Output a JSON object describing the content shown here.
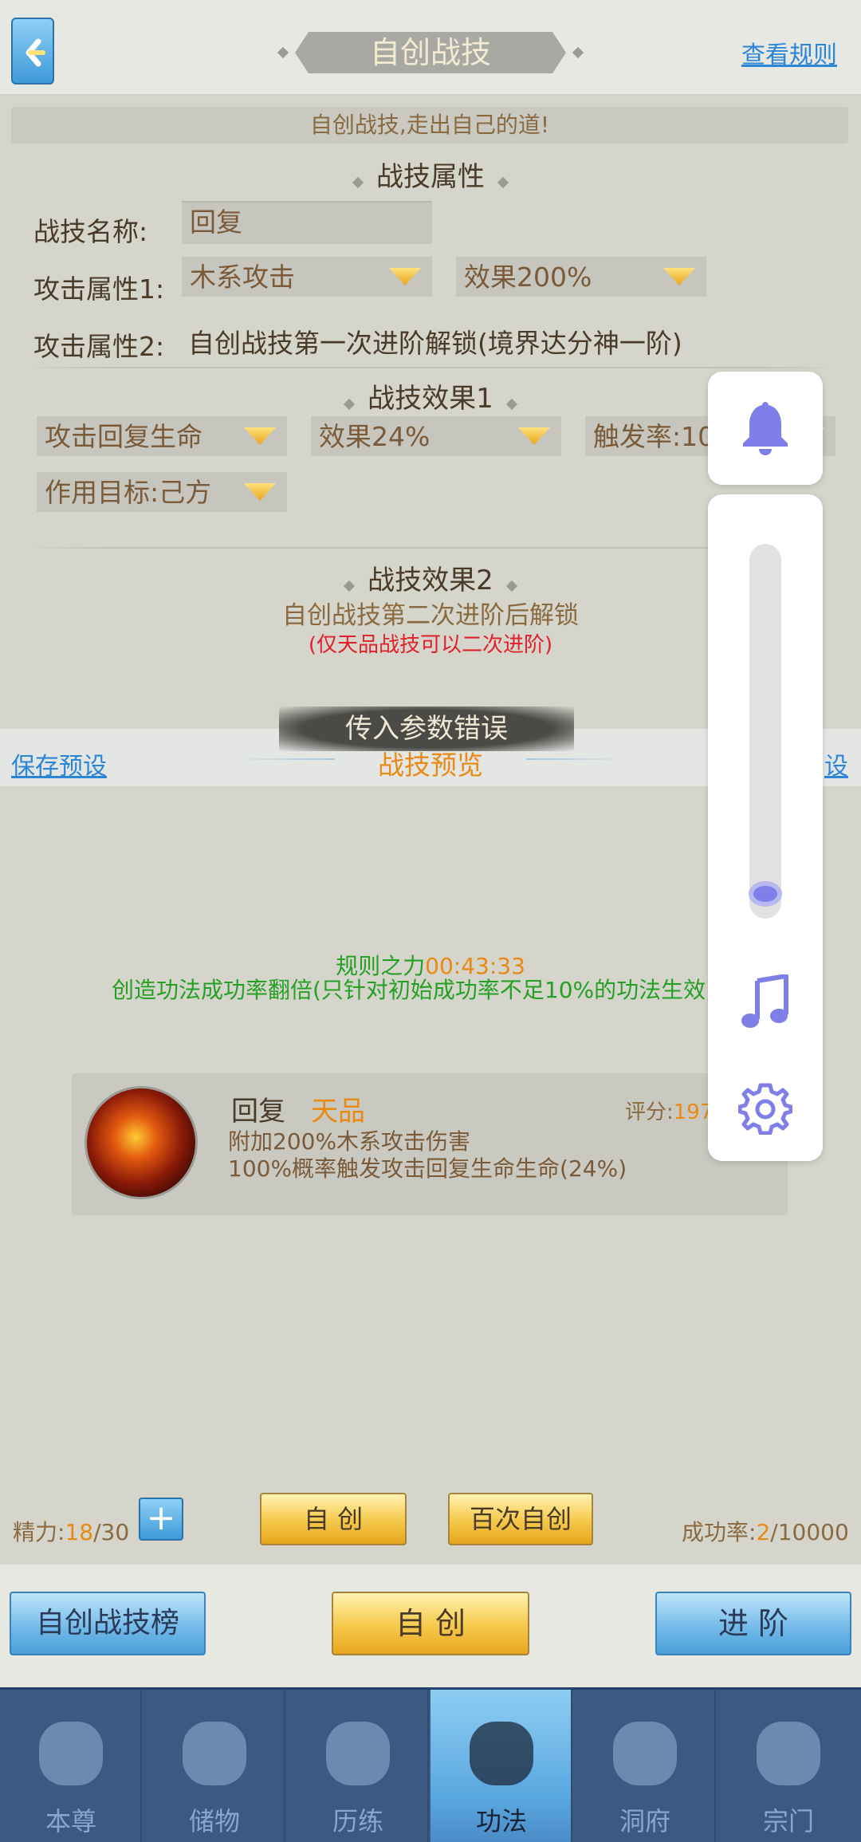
{
  "header": {
    "title": "自创战技",
    "rules_link": "查看规则"
  },
  "slogan": "自创战技,走出自己的道!",
  "attributes": {
    "section_title": "战技属性",
    "name_label": "战技名称:",
    "name_value": "回复",
    "attack1_label": "攻击属性1:",
    "attack1_type": "木系攻击",
    "attack1_effect": "效果200%",
    "attack2_label": "攻击属性2:",
    "attack2_value": "自创战技第一次进阶解锁(境界达分神一阶)"
  },
  "effect1": {
    "section_title": "战技效果1",
    "type": "攻击回复生命",
    "effect": "效果24%",
    "trigger_rate": "触发率:10",
    "target": "作用目标:己方"
  },
  "effect2": {
    "section_title": "战技效果2",
    "locked_text": "自创战技第二次进阶后解锁",
    "note": "(仅天品战技可以二次进阶)"
  },
  "toast": "传入参数错误",
  "preview": {
    "save_preset": "保存预设",
    "title": "战技预览",
    "load_preset": "设"
  },
  "rule_power": {
    "label": "规则之力",
    "timer": "00:43:33",
    "description": "创造功法成功率翻倍(只针对初始成功率不足10%的功法生效)"
  },
  "skill": {
    "name": "回复",
    "grade": "天品",
    "score_label": "评分:",
    "score_value": "197",
    "desc1": "附加200%木系攻击伤害",
    "desc2": "100%概率触发攻击回复生命生命(24%)"
  },
  "energy": {
    "label": "精力:",
    "current": "18",
    "max": "/30"
  },
  "create_buttons": {
    "create": "自 创",
    "hundred": "百次自创"
  },
  "success_rate": {
    "label": "成功率:",
    "current": "2",
    "max": "/10000"
  },
  "actions": {
    "ranking": "自创战技榜",
    "create": "自 创",
    "advance": "进 阶"
  },
  "nav": [
    {
      "label": "本尊",
      "icon": "character-icon"
    },
    {
      "label": "储物",
      "icon": "bag-icon"
    },
    {
      "label": "历练",
      "icon": "mountain-icon"
    },
    {
      "label": "功法",
      "icon": "book-icon"
    },
    {
      "label": "洞府",
      "icon": "cave-icon"
    },
    {
      "label": "宗门",
      "icon": "gate-icon"
    }
  ],
  "nav_active_index": 3,
  "floating_panel": {
    "volume_level": 0.03
  },
  "colors": {
    "accent_orange": "#e88a14",
    "link_blue": "#2c86d8",
    "green_text": "#24a024",
    "red_note": "#e0202a",
    "panel_purple": "#7f7fe8"
  }
}
